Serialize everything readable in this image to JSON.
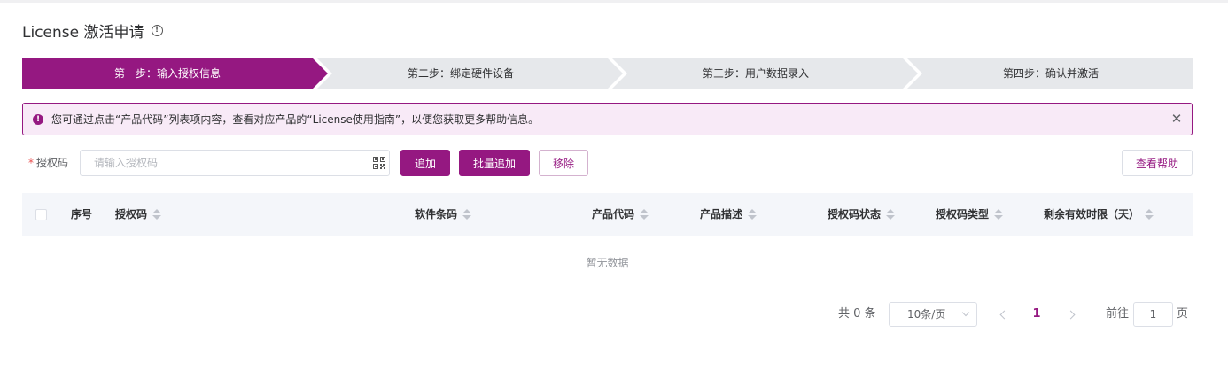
{
  "page": {
    "title": "License 激活申请",
    "info_icon": "info-circle-icon"
  },
  "steps": [
    {
      "label": "第一步：输入授权信息",
      "active": true
    },
    {
      "label": "第二步：绑定硬件设备",
      "active": false
    },
    {
      "label": "第三步：用户数据录入",
      "active": false
    },
    {
      "label": "第四步：确认并激活",
      "active": false
    }
  ],
  "alert": {
    "icon": "exclamation-circle-icon",
    "text": "您可通过点击“产品代码”列表项内容，查看对应产品的“License使用指南”，以便您获取更多帮助信息。",
    "close_icon": "close-icon"
  },
  "form": {
    "required_mark": "*",
    "label": "授权码",
    "input_value": "",
    "input_placeholder": "请输入授权码",
    "scan_icon": "qr-code-icon",
    "add_label": "追加",
    "batch_add_label": "批量追加",
    "remove_label": "移除",
    "help_label": "查看帮助"
  },
  "table": {
    "columns": [
      {
        "label": "序号",
        "sortable": false
      },
      {
        "label": "授权码",
        "sortable": true
      },
      {
        "label": "软件条码",
        "sortable": true
      },
      {
        "label": "产品代码",
        "sortable": true
      },
      {
        "label": "产品描述",
        "sortable": true
      },
      {
        "label": "授权码状态",
        "sortable": true
      },
      {
        "label": "授权码类型",
        "sortable": true
      },
      {
        "label": "剩余有效时限（天）",
        "sortable": true
      }
    ],
    "empty_text": "暂无数据"
  },
  "pagination": {
    "total_text": "共 0 条",
    "page_size": "10条/页",
    "current_page": "1",
    "goto_label": "前往",
    "goto_value": "1",
    "page_unit": "页"
  },
  "colors": {
    "brand": "#951881",
    "step_inactive": "#e6e8eb",
    "alert_bg": "#f8eaf7",
    "table_header_bg": "#f4f6fa"
  }
}
